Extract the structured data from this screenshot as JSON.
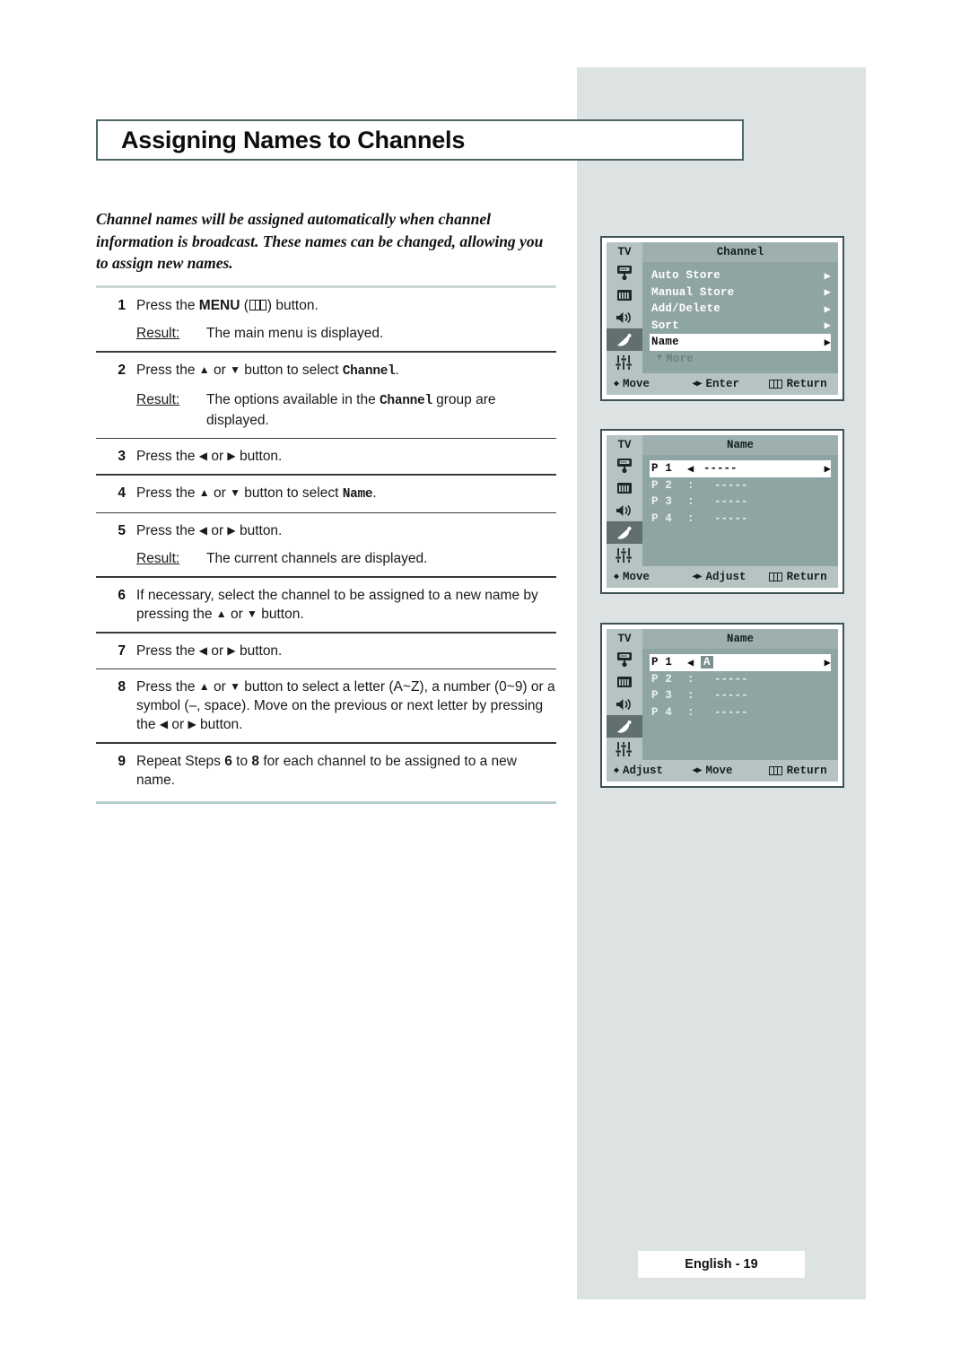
{
  "page": {
    "title": "Assigning Names to Channels",
    "intro": "Channel names will be assigned automatically when channel information is broadcast. These names can be changed, allowing you to assign new names.",
    "footer_tag": "English - 19",
    "accent_border": "#4e6668",
    "panel_bg": "#dde2e2",
    "rule_color": "#c7d8d7",
    "osd_bg": "#8fa5a4",
    "osd_chrome": "#b5c4c3"
  },
  "steps": [
    {
      "num": "1",
      "prefix": "Press the ",
      "bold": "MENU",
      "middle": " (",
      "icon": "menu-icon",
      "suffix": ") button.",
      "result_label": "Result:",
      "result_text": "The main menu is displayed."
    },
    {
      "num": "2",
      "text_a": "Press the ",
      "up": "▲",
      "or": " or ",
      "down": "▼",
      "text_b": " button to select ",
      "mono": "Channel",
      "text_c": ".",
      "result_label": "Result:",
      "result_a": "The options available in the ",
      "result_mono": "Channel",
      "result_b": " group are displayed."
    },
    {
      "num": "3",
      "text_a": "Press the ",
      "left": "◀",
      "or": " or ",
      "right": "▶",
      "text_b": " button."
    },
    {
      "num": "4",
      "text_a": "Press the ",
      "up": "▲",
      "or": " or ",
      "down": "▼",
      "text_b": " button to select ",
      "mono": "Name",
      "text_c": "."
    },
    {
      "num": "5",
      "text_a": "Press the ",
      "left": "◀",
      "or": " or ",
      "right": "▶",
      "text_b": " button.",
      "result_label": "Result:",
      "result_text": "The current channels are displayed."
    },
    {
      "num": "6",
      "text_a": "If necessary, select the channel to be assigned to a new name by pressing the ",
      "up": "▲",
      "or": " or ",
      "down": "▼",
      "text_b": " button."
    },
    {
      "num": "7",
      "text_a": "Press the ",
      "left": "◀",
      "or": " or ",
      "right": "▶",
      "text_b": " button."
    },
    {
      "num": "8",
      "text_a": "Press the ",
      "up": "▲",
      "or": " or ",
      "down": "▼",
      "text_b": " button to select a letter (A~Z), a number (0~9) or a symbol (–, space).  Move on the previous or next letter by pressing the ",
      "left": "◀",
      "or2": " or ",
      "right": "▶",
      "text_c": " button."
    },
    {
      "num": "9",
      "text_a": "Repeat Steps ",
      "b1": "6",
      "text_b": " to ",
      "b2": "8",
      "text_c": " for each channel to be assigned to a new name."
    }
  ],
  "osd": {
    "tv_label": "TV",
    "icons": [
      "picture-icon",
      "bars-icon",
      "speaker-icon",
      "satellite-dish-icon",
      "sliders-icon"
    ],
    "panel1": {
      "title": "Channel",
      "rows": [
        {
          "label": "Auto Store",
          "arrow": "▶",
          "selected": false
        },
        {
          "label": "Manual Store",
          "arrow": "▶",
          "selected": false
        },
        {
          "label": "Add/Delete",
          "arrow": "▶",
          "selected": false
        },
        {
          "label": "Sort",
          "arrow": "▶",
          "selected": false
        },
        {
          "label": "Name",
          "arrow": "▶",
          "selected": true
        }
      ],
      "more": "More",
      "more_arrow": "▼",
      "footer": [
        {
          "glyph": "up-down-icon",
          "label": "Move"
        },
        {
          "glyph": "left-right-icon",
          "label": "Enter"
        },
        {
          "glyph": "menu-icon",
          "label": "Return"
        }
      ]
    },
    "panel2": {
      "title": "Name",
      "rows": [
        {
          "p": "P 1",
          "sep": "",
          "left": "◀",
          "value": "-----",
          "right": "▶",
          "selected": true
        },
        {
          "p": "P 2",
          "sep": ":",
          "value": "-----",
          "selected": false
        },
        {
          "p": "P 3",
          "sep": ":",
          "value": "-----",
          "selected": false
        },
        {
          "p": "P 4",
          "sep": ":",
          "value": "-----",
          "selected": false
        }
      ],
      "footer": [
        {
          "glyph": "up-down-icon",
          "label": "Move"
        },
        {
          "glyph": "left-right-icon",
          "label": "Adjust"
        },
        {
          "glyph": "menu-icon",
          "label": "Return"
        }
      ]
    },
    "panel3": {
      "title": "Name",
      "rows": [
        {
          "p": "P 1",
          "sep": "",
          "left": "◀",
          "value": "A",
          "right": "▶",
          "selected": true,
          "char_highlight": true
        },
        {
          "p": "P 2",
          "sep": ":",
          "value": "-----",
          "selected": false
        },
        {
          "p": "P 3",
          "sep": ":",
          "value": "-----",
          "selected": false
        },
        {
          "p": "P 4",
          "sep": ":",
          "value": "-----",
          "selected": false
        }
      ],
      "footer": [
        {
          "glyph": "up-down-icon",
          "label": "Adjust"
        },
        {
          "glyph": "left-right-icon",
          "label": "Move"
        },
        {
          "glyph": "menu-icon",
          "label": "Return"
        }
      ]
    }
  }
}
